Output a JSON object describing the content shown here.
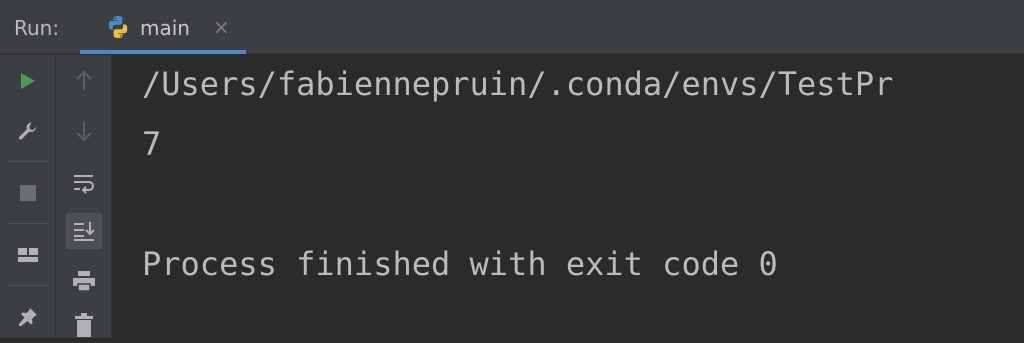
{
  "header": {
    "run_label": "Run:",
    "tab": {
      "label": "main",
      "close": "×",
      "icon": "python-icon"
    }
  },
  "toolbar_left": [
    {
      "name": "rerun-icon",
      "color": "#499c54"
    },
    {
      "name": "wrench-icon"
    },
    {
      "name": "stop-icon"
    },
    {
      "name": "layout-icon"
    },
    {
      "name": "pin-icon"
    }
  ],
  "toolbar_right": [
    {
      "name": "up-arrow-icon"
    },
    {
      "name": "down-arrow-icon"
    },
    {
      "name": "soft-wrap-icon"
    },
    {
      "name": "scroll-to-end-icon",
      "selected": true
    },
    {
      "name": "print-icon"
    },
    {
      "name": "trash-icon"
    }
  ],
  "console": {
    "lines": [
      "/Users/fabiennepruin/.conda/envs/TestPr",
      "7",
      "",
      "Process finished with exit code 0"
    ]
  },
  "colors": {
    "accent": "#4a88c7",
    "run_green": "#499c54",
    "background": "#2b2b2b",
    "panel": "#3c3f41"
  }
}
